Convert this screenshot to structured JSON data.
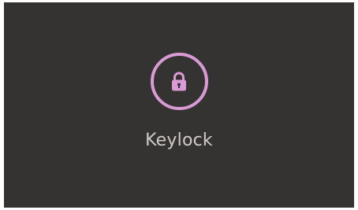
{
  "screen": {
    "label": "Keylock",
    "icon": "padlock-icon"
  },
  "colors": {
    "background": "#353332",
    "accent": "#d99ad6",
    "text": "#cfcbc8"
  }
}
